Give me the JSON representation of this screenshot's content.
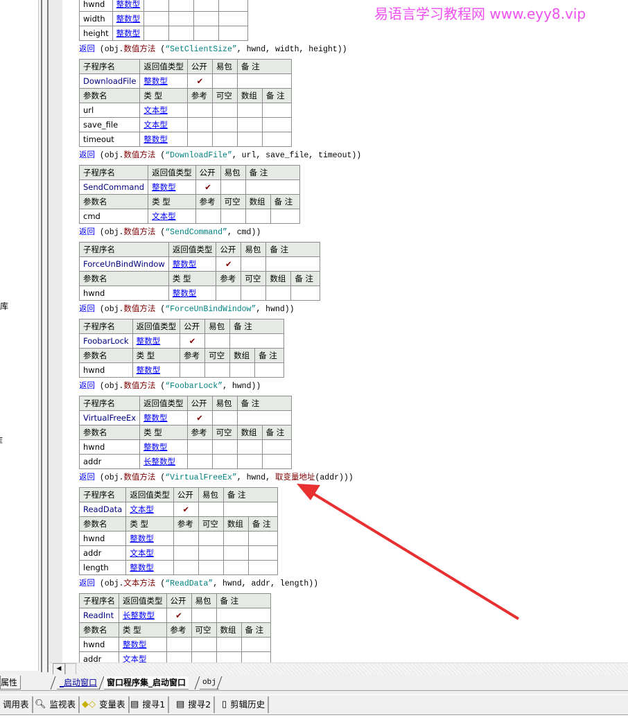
{
  "watermark": "易语言学习教程网 www.eyy8.vip",
  "left_panel": {
    "text_1": "库",
    "text_2": "库"
  },
  "labels": {
    "sub_name": "子程序名",
    "return_type": "返回值类型",
    "public": "公开",
    "easy_pkg": "易包",
    "remark": "备 注",
    "param_name": "参数名",
    "type": "类 型",
    "ref": "参考",
    "nullable": "可空",
    "array": "数组",
    "check": "✔"
  },
  "subroutines": [
    {
      "name": null,
      "return_type": null,
      "public": false,
      "params": [
        {
          "name": "hwnd",
          "type": "整数型"
        },
        {
          "name": "width",
          "type": "整数型"
        },
        {
          "name": "height",
          "type": "整数型"
        }
      ],
      "return_line": [
        {
          "t": "kw",
          "v": "返回"
        },
        {
          "t": "plain",
          "v": " (obj."
        },
        {
          "t": "method",
          "v": "数值方法"
        },
        {
          "t": "plain",
          "v": " ("
        },
        {
          "t": "str",
          "v": "“SetClientSize”"
        },
        {
          "t": "plain",
          "v": ", hwnd, width, height))"
        }
      ]
    },
    {
      "name": "DownloadFile",
      "return_type": "整数型",
      "public": true,
      "params": [
        {
          "name": "url",
          "type": "文本型"
        },
        {
          "name": "save_file",
          "type": "文本型"
        },
        {
          "name": "timeout",
          "type": "整数型"
        }
      ],
      "return_line": [
        {
          "t": "kw",
          "v": "返回"
        },
        {
          "t": "plain",
          "v": " (obj."
        },
        {
          "t": "method",
          "v": "数值方法"
        },
        {
          "t": "plain",
          "v": " ("
        },
        {
          "t": "str",
          "v": "“DownloadFile”"
        },
        {
          "t": "plain",
          "v": ", url, save_file, timeout))"
        }
      ]
    },
    {
      "name": "SendCommand",
      "return_type": "整数型",
      "public": true,
      "params": [
        {
          "name": "cmd",
          "type": "文本型"
        }
      ],
      "return_line": [
        {
          "t": "kw",
          "v": "返回"
        },
        {
          "t": "plain",
          "v": " (obj."
        },
        {
          "t": "method",
          "v": "数值方法"
        },
        {
          "t": "plain",
          "v": " ("
        },
        {
          "t": "str",
          "v": "“SendCommand”"
        },
        {
          "t": "plain",
          "v": ", cmd))"
        }
      ]
    },
    {
      "name": "ForceUnBindWindow",
      "return_type": "整数型",
      "public": true,
      "params": [
        {
          "name": "hwnd",
          "type": "整数型"
        }
      ],
      "return_line": [
        {
          "t": "kw",
          "v": "返回"
        },
        {
          "t": "plain",
          "v": " (obj."
        },
        {
          "t": "method",
          "v": "数值方法"
        },
        {
          "t": "plain",
          "v": " ("
        },
        {
          "t": "str",
          "v": "“ForceUnBindWindow”"
        },
        {
          "t": "plain",
          "v": ", hwnd))"
        }
      ]
    },
    {
      "name": "FoobarLock",
      "return_type": "整数型",
      "public": true,
      "params": [
        {
          "name": "hwnd",
          "type": "整数型"
        }
      ],
      "return_line": [
        {
          "t": "kw",
          "v": "返回"
        },
        {
          "t": "plain",
          "v": " (obj."
        },
        {
          "t": "method",
          "v": "数值方法"
        },
        {
          "t": "plain",
          "v": " ("
        },
        {
          "t": "str",
          "v": "“FoobarLock”"
        },
        {
          "t": "plain",
          "v": ", hwnd))"
        }
      ]
    },
    {
      "name": "VirtualFreeEx",
      "return_type": "整数型",
      "public": true,
      "params": [
        {
          "name": "hwnd",
          "type": "整数型"
        },
        {
          "name": "addr",
          "type": "长整数型"
        }
      ],
      "return_line": [
        {
          "t": "kw",
          "v": "返回"
        },
        {
          "t": "plain",
          "v": " (obj."
        },
        {
          "t": "method",
          "v": "数值方法"
        },
        {
          "t": "plain",
          "v": " ("
        },
        {
          "t": "str",
          "v": "“VirtualFreeEx”"
        },
        {
          "t": "plain",
          "v": ", hwnd, "
        },
        {
          "t": "func",
          "v": "取变量地址"
        },
        {
          "t": "plain",
          "v": "(addr)))"
        }
      ]
    },
    {
      "name": "ReadData",
      "return_type": "文本型",
      "public": true,
      "params": [
        {
          "name": "hwnd",
          "type": "整数型"
        },
        {
          "name": "addr",
          "type": "文本型"
        },
        {
          "name": "length",
          "type": "整数型"
        }
      ],
      "return_line": [
        {
          "t": "kw",
          "v": "返回"
        },
        {
          "t": "plain",
          "v": " (obj."
        },
        {
          "t": "method",
          "v": "文本方法"
        },
        {
          "t": "plain",
          "v": " ("
        },
        {
          "t": "str",
          "v": "“ReadData”"
        },
        {
          "t": "plain",
          "v": ", hwnd, addr, length))"
        }
      ]
    },
    {
      "name": "ReadInt",
      "return_type": "长整数型",
      "public": true,
      "params": [
        {
          "name": "hwnd",
          "type": "整数型"
        },
        {
          "name": "addr",
          "type": "文本型"
        },
        {
          "name": "",
          "type": ""
        }
      ],
      "return_line": []
    }
  ],
  "annotation_color": "#e83030",
  "tabs": {
    "properties": "属性",
    "items": [
      "_启动窗口",
      "窗口程序集_启动窗口",
      "obj"
    ],
    "active": 1
  },
  "toolbar": [
    {
      "label": "调用表",
      "icon": ""
    },
    {
      "label": "监视表",
      "icon": "magnifier-icon"
    },
    {
      "label": "变量表",
      "icon": "variables-icon"
    },
    {
      "label": "搜寻1",
      "icon": "search-list-icon"
    },
    {
      "label": "搜寻2",
      "icon": "search-list-icon"
    },
    {
      "label": "剪辑历史",
      "icon": "clipboard-icon"
    }
  ]
}
